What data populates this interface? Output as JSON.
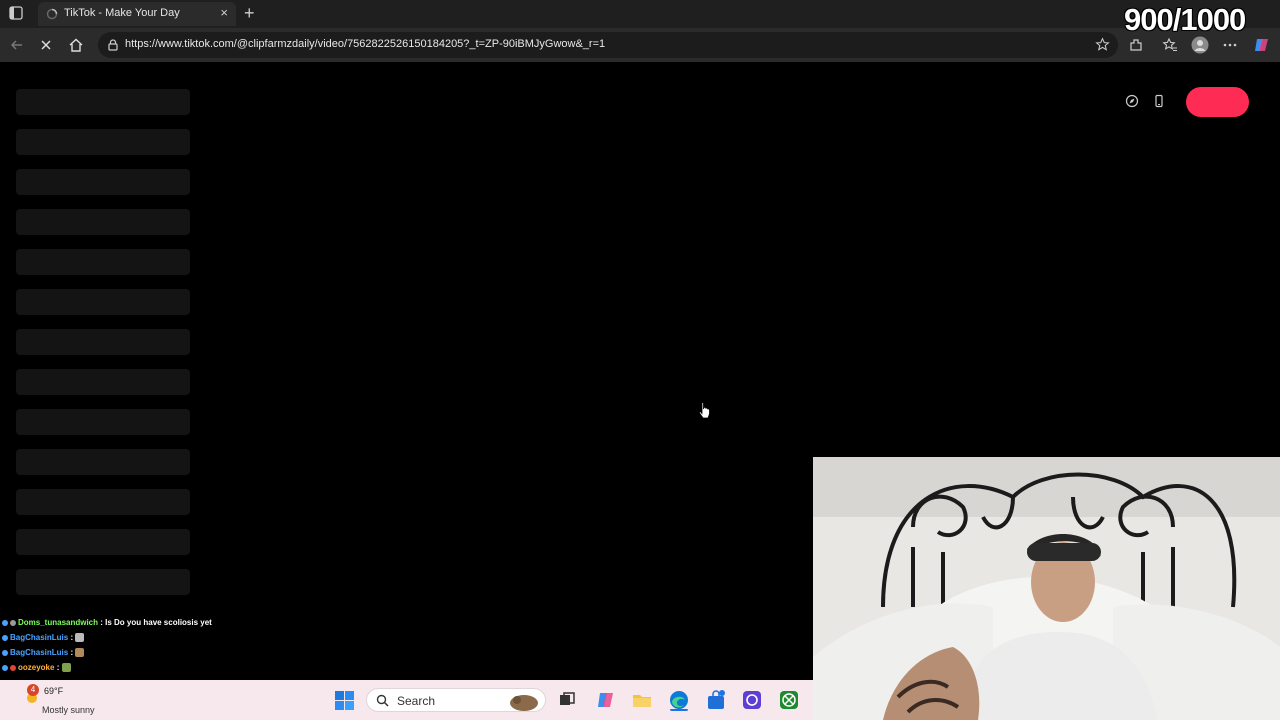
{
  "browser": {
    "tab_title": "TikTok - Make Your Day",
    "tab_close": "×",
    "new_tab": "+",
    "url": "https://www.tiktok.com/@clipfarmzdaily/video/7562822526150184205?_t=ZP-90iBMJyGwow&_r=1"
  },
  "overlay": {
    "counter": "900/1000"
  },
  "chat": {
    "messages": [
      {
        "user": "Doms_tunasandwich",
        "user_color": "#7dff5a",
        "text": " : Is Do you have scoliosis yet"
      },
      {
        "user": "BagChasinLuis",
        "user_color": "#4aa3ff",
        "text": " :"
      },
      {
        "user": "BagChasinLuis",
        "user_color": "#4aa3ff",
        "text": " :"
      },
      {
        "user": "oozeyoke",
        "user_color": "#ffb13b",
        "text": " :"
      }
    ]
  },
  "taskbar": {
    "weather_temp": "69°F",
    "weather_desc": "Mostly sunny",
    "weather_badge": "4",
    "search_label": "Search"
  },
  "colors": {
    "tiktok_accent": "#fe2c55",
    "taskbar_bg": "#f6e8ec"
  }
}
